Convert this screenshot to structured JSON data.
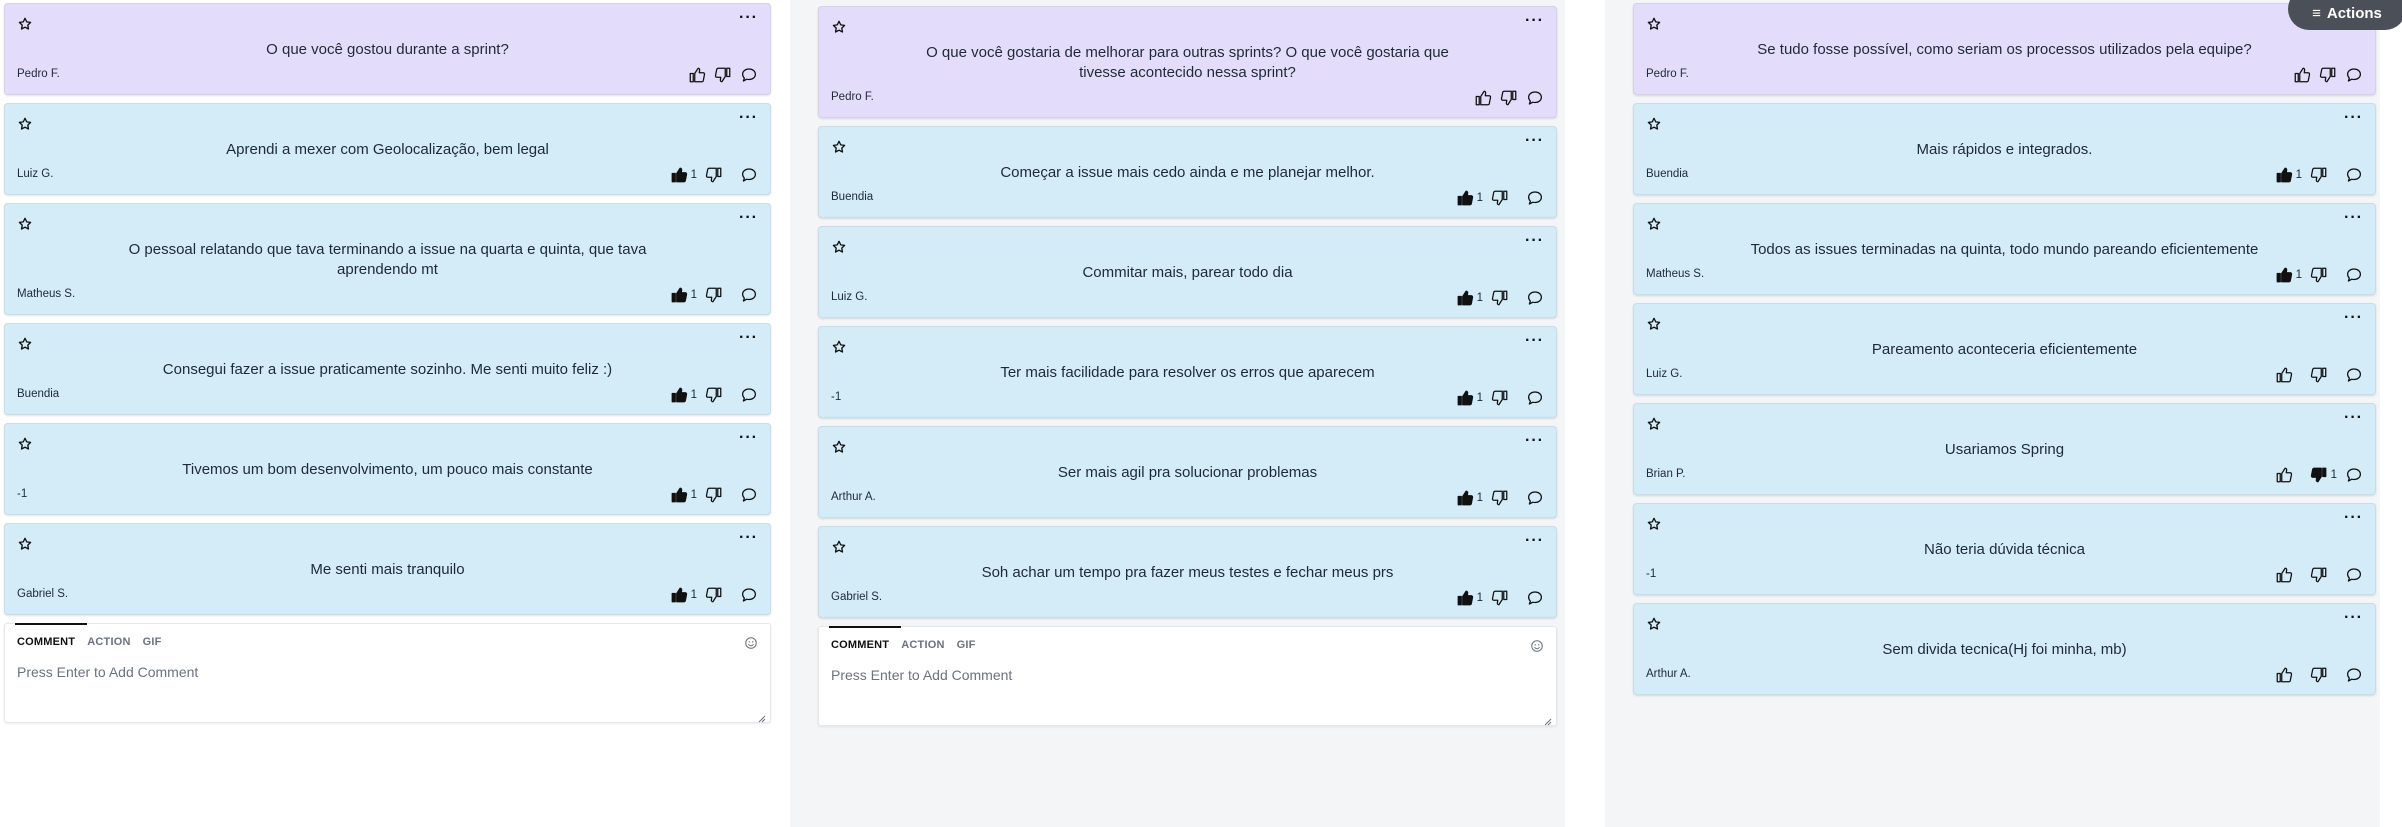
{
  "actions_button": {
    "label": "Actions",
    "icon": "menu-icon"
  },
  "columns": [
    {
      "header": {
        "text": "O que você gostou durante a sprint?",
        "author": "Pedro F."
      },
      "cards": [
        {
          "text": "Aprendi a mexer com Geolocalização, bem legal",
          "author": "Luiz G.",
          "likes": "1",
          "dislikes": ""
        },
        {
          "text": "O pessoal relatando que tava terminando a issue na quarta e quinta, que tava aprendendo mt",
          "author": "Matheus S.",
          "likes": "1",
          "dislikes": ""
        },
        {
          "text": "Consegui fazer a issue praticamente sozinho. Me senti muito feliz :)",
          "author": "Buendia",
          "likes": "1",
          "dislikes": ""
        },
        {
          "text": "Tivemos um bom desenvolvimento, um pouco mais constante",
          "author": "-1",
          "likes": "1",
          "dislikes": ""
        },
        {
          "text": "Me senti mais tranquilo",
          "author": "Gabriel S.",
          "likes": "1",
          "dislikes": ""
        }
      ],
      "comment": {
        "tabs": [
          "COMMENT",
          "ACTION",
          "GIF"
        ],
        "placeholder": "Press Enter to Add Comment"
      }
    },
    {
      "header": {
        "text": "O que você gostaria de melhorar para outras sprints? O que você gostaria que tivesse acontecido nessa sprint?",
        "author": "Pedro F."
      },
      "cards": [
        {
          "text": "Começar a issue mais cedo ainda e me planejar melhor.",
          "author": "Buendia",
          "likes": "1",
          "dislikes": ""
        },
        {
          "text": "Commitar mais, parear todo dia",
          "author": "Luiz G.",
          "likes": "1",
          "dislikes": ""
        },
        {
          "text": "Ter mais facilidade para resolver os erros que aparecem",
          "author": "-1",
          "likes": "1",
          "dislikes": ""
        },
        {
          "text": "Ser mais agil pra solucionar problemas",
          "author": "Arthur A.",
          "likes": "1",
          "dislikes": ""
        },
        {
          "text": "Soh achar um tempo pra fazer meus testes e fechar meus prs",
          "author": "Gabriel S.",
          "likes": "1",
          "dislikes": ""
        }
      ],
      "comment": {
        "tabs": [
          "COMMENT",
          "ACTION",
          "GIF"
        ],
        "placeholder": "Press Enter to Add Comment"
      }
    },
    {
      "header": {
        "text": "Se tudo fosse possível, como seriam os processos utilizados pela equipe?",
        "author": "Pedro F."
      },
      "cards": [
        {
          "text": "Mais rápidos e integrados.",
          "author": "Buendia",
          "likes": "1",
          "dislikes": ""
        },
        {
          "text": "Todos as issues terminadas na quinta, todo mundo pareando eficientemente",
          "author": "Matheus S.",
          "likes": "1",
          "dislikes": ""
        },
        {
          "text": "Pareamento aconteceria eficientemente",
          "author": "Luiz G.",
          "likes": "",
          "dislikes": ""
        },
        {
          "text": "Usariamos Spring",
          "author": "Brian P.",
          "likes": "",
          "dislikes": "1"
        },
        {
          "text": "Não teria dúvida técnica",
          "author": "-1",
          "likes": "",
          "dislikes": ""
        },
        {
          "text": "Sem divida tecnica(Hj foi minha, mb)",
          "author": "Arthur A.",
          "likes": "",
          "dislikes": ""
        }
      ],
      "comment": null
    }
  ]
}
